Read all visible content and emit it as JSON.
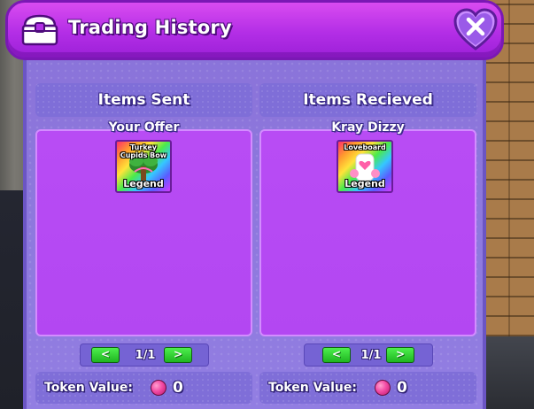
{
  "window": {
    "title": "Trading History",
    "title_icon": "chest-icon",
    "close_icon": "heart-close-icon",
    "accent_color": "#b32ee6"
  },
  "panels": [
    {
      "header": "Items Sent",
      "owner": "Your Offer",
      "items": [
        {
          "name": "Turkey Cupids Bow",
          "rarity": "Legend",
          "icon": "cupid-bow-tree-icon"
        }
      ],
      "pager": {
        "prev": "<",
        "page": "1/1",
        "next": ">"
      },
      "token_label": "Token Value:",
      "token_value": "0"
    },
    {
      "header": "Items Recieved",
      "owner": "Kray Dizzy",
      "items": [
        {
          "name": "Loveboard",
          "rarity": "Legend",
          "icon": "loveboard-icon"
        }
      ],
      "pager": {
        "prev": "<",
        "page": "1/1",
        "next": ">"
      },
      "token_label": "Token Value:",
      "token_value": "0"
    }
  ],
  "colors": {
    "title_bar": "#b32ee6",
    "panel_bg": "#b84cf4",
    "pager_button": "#2ed02f",
    "token": "#f24aa4",
    "rarity_legend": "rainbow"
  }
}
